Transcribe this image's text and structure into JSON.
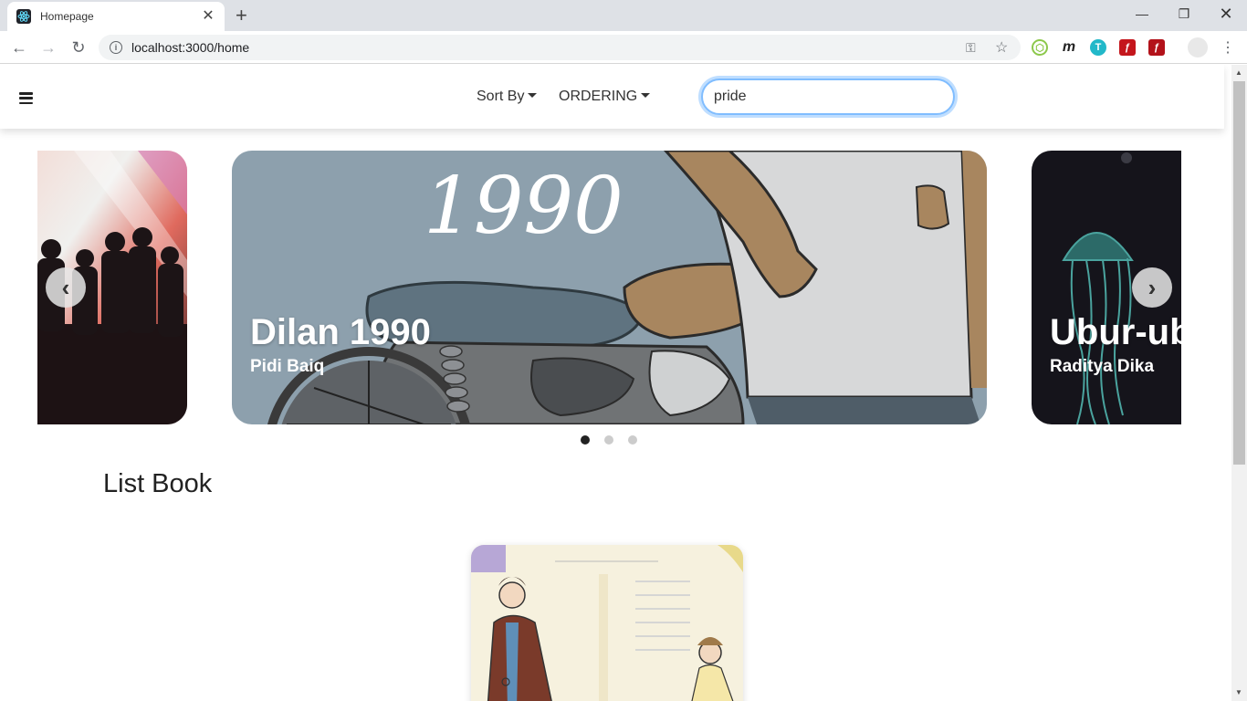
{
  "browser": {
    "tab_title": "Homepage",
    "url": "localhost:3000/home"
  },
  "navbar": {
    "sort_label": "Sort By",
    "ordering_label": "ORDERING",
    "search_value": "pride"
  },
  "carousel": {
    "slides": [
      {
        "title": "Dilan 1990",
        "author": "Pidi Baiq"
      },
      {
        "title": "Ubur-ub",
        "author": "Raditya Dika"
      }
    ],
    "cover_text": "1990",
    "dots_count": 3,
    "active_dot": 1
  },
  "section": {
    "title": "List Book"
  }
}
